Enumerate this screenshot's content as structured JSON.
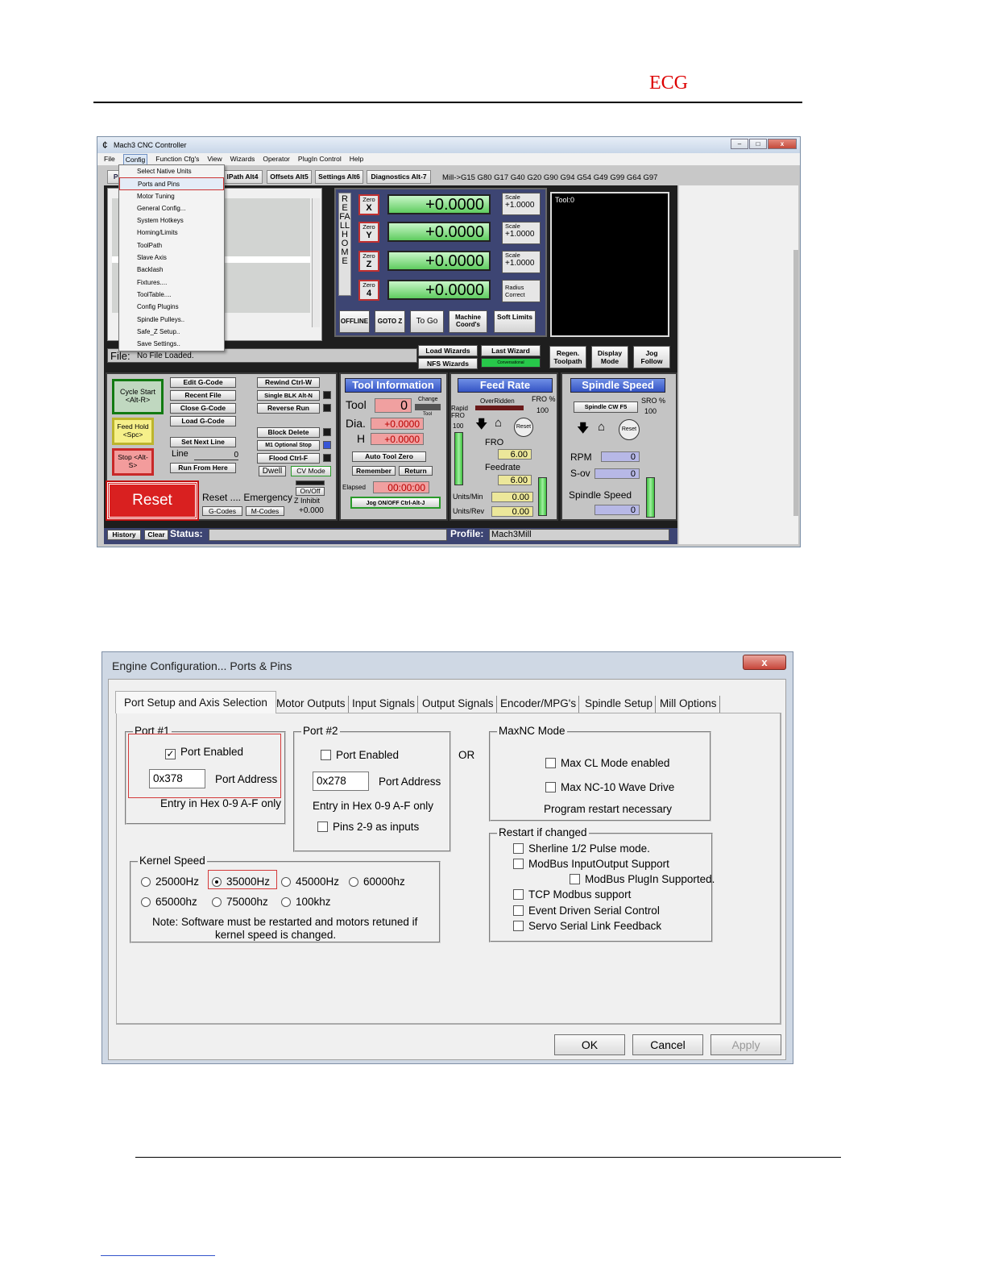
{
  "doc": {
    "header_text": "ECG"
  },
  "mach3": {
    "title": "Mach3 CNC Controller",
    "menu": [
      "File",
      "Config",
      "Function Cfg's",
      "View",
      "Wizards",
      "Operator",
      "PlugIn Control",
      "Help"
    ],
    "config_menu": [
      "Select Native Units",
      "Ports and Pins",
      "Motor Tuning",
      "General Config...",
      "System Hotkeys",
      "Homing/Limits",
      "ToolPath",
      "Slave Axis",
      "Backlash",
      "Fixtures....",
      "ToolTable....",
      "Config Plugins",
      "Spindle Pulleys..",
      "Safe_Z Setup..",
      "Save Settings.."
    ],
    "tabs": [
      "Pro",
      "lPath Alt4",
      "Offsets Alt5",
      "Settings Alt6",
      "Diagnostics Alt-7"
    ],
    "gcodes": "Mill->G15  G80 G17 G40 G20 G90 G94 G54 G49 G99 G64 G97",
    "ref_all_home": "REFALLHOME",
    "axes": [
      {
        "zero": "Zero",
        "axis": "X",
        "value": "+0.0000",
        "side_label": "Scale",
        "side_value": "+1.0000"
      },
      {
        "zero": "Zero",
        "axis": "Y",
        "value": "+0.0000",
        "side_label": "Scale",
        "side_value": "+1.0000"
      },
      {
        "zero": "Zero",
        "axis": "Z",
        "value": "+0.0000",
        "side_label": "Scale",
        "side_value": "+1.0000"
      },
      {
        "zero": "Zero",
        "axis": "4",
        "value": "+0.0000",
        "side_label": "Radius Correct",
        "side_value": ""
      }
    ],
    "dro_buttons": [
      "OFFLINE",
      "GOTO Z",
      "To Go",
      "Machine Coord's",
      "Soft Limits"
    ],
    "tool_display": "Tool:0",
    "file_label": "File:",
    "file_value": "No File Loaded.",
    "wizard_buttons": [
      "Load Wizards",
      "Last Wizard",
      "NFS Wizards",
      "Conversational"
    ],
    "view_buttons": [
      "Regen. Toolpath",
      "Display Mode",
      "Jog Follow"
    ],
    "cycle_start": "Cycle Start <Alt-R>",
    "feed_hold": "Feed Hold <Spc>",
    "stop": "Stop <Alt-S>",
    "file_buttons": [
      "Edit G-Code",
      "Recent File",
      "Close G-Code",
      "Load G-Code",
      "Set Next Line",
      "Run From Here"
    ],
    "line_label": "Line",
    "line_value": "0",
    "run_buttons": [
      "Rewind Ctrl-W",
      "Single BLK Alt-N",
      "Reverse Run",
      "Block Delete",
      "M1 Optional Stop",
      "Flood Ctrl-F"
    ],
    "dwell": "Dwell",
    "cv_mode": "CV Mode",
    "reset": "Reset",
    "reset_text": "Reset .... Emergency",
    "gcodes_btn": "G-Codes",
    "mcodes_btn": "M-Codes",
    "onoff": "On/Off",
    "z_inhibit": "Z Inhibit",
    "z_inhibit_value": "+0.000",
    "tool_info": {
      "header": "Tool Information",
      "tool_label": "Tool",
      "tool_value": "0",
      "change": "Change",
      "tool_small": "Tool",
      "dia_label": "Dia.",
      "dia_value": "+0.0000",
      "h_label": "H",
      "h_value": "+0.0000",
      "auto_tool_zero": "Auto Tool Zero",
      "remember": "Remember",
      "return": "Return",
      "elapsed_label": "Elapsed",
      "elapsed_value": "00:00:00",
      "jog": "Jog ON/OFF Ctrl-Alt-J"
    },
    "feed": {
      "header": "Feed Rate",
      "overridden": "OverRidden",
      "fro_pct": "FRO %",
      "fro_pct_value": "100",
      "rapid": "Rapid FRO",
      "rapid_value": "100",
      "reset": "Reset",
      "fro_label": "FRO",
      "fro_value": "6.00",
      "feedrate_label": "Feedrate",
      "feedrate_value": "6.00",
      "units_min_label": "Units/Min",
      "units_min_value": "0.00",
      "units_rev_label": "Units/Rev",
      "units_rev_value": "0.00"
    },
    "spindle": {
      "header": "Spindle Speed",
      "cw": "Spindle CW F5",
      "sro_pct": "SRO %",
      "sro_value": "100",
      "reset": "Reset",
      "rpm_label": "RPM",
      "rpm_value": "0",
      "sov_label": "S-ov",
      "sov_value": "0",
      "speed_label": "Spindle Speed",
      "speed_value": "0"
    },
    "history": "History",
    "clear": "Clear",
    "status_label": "Status:",
    "status_value": "",
    "profile_label": "Profile:",
    "profile_value": "Mach3Mill"
  },
  "dialog": {
    "title": "Engine Configuration... Ports & Pins",
    "close": "x",
    "tabs": [
      "Port Setup and Axis Selection",
      "Motor Outputs",
      "Input Signals",
      "Output Signals",
      "Encoder/MPG's",
      "Spindle Setup",
      "Mill Options"
    ],
    "port1": {
      "title": "Port #1",
      "enabled_label": "Port Enabled",
      "enabled": true,
      "address": "0x378",
      "address_label": "Port Address",
      "hint": "Entry in Hex 0-9 A-F only"
    },
    "port2": {
      "title": "Port #2",
      "enabled_label": "Port Enabled",
      "enabled": false,
      "address": "0x278",
      "address_label": "Port Address",
      "hint": "Entry in Hex 0-9 A-F only",
      "pins_label": "Pins 2-9 as inputs"
    },
    "or": "OR",
    "maxnc": {
      "title": "MaxNC Mode",
      "opt1": "Max CL Mode enabled",
      "opt2": "Max NC-10 Wave Drive",
      "note": "Program restart necessary"
    },
    "kernel": {
      "title": "Kernel Speed",
      "options": [
        "25000Hz",
        "35000Hz",
        "45000Hz",
        "60000hz",
        "65000hz",
        "75000hz",
        "100khz"
      ],
      "selected": "35000Hz",
      "note1": "Note: Software must be restarted and motors retuned if",
      "note2": "kernel speed is changed."
    },
    "restart": {
      "title": "Restart if changed",
      "options": [
        "Sherline 1/2 Pulse mode.",
        "ModBus InputOutput Support",
        "ModBus PlugIn Supported.",
        "TCP Modbus support",
        "Event Driven Serial Control",
        "Servo Serial Link Feedback"
      ]
    },
    "buttons": {
      "ok": "OK",
      "cancel": "Cancel",
      "apply": "Apply"
    }
  }
}
